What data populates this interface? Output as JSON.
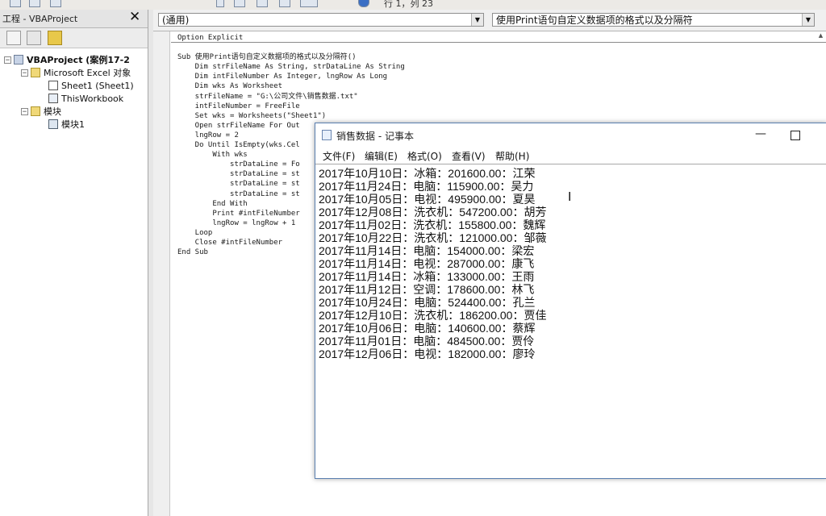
{
  "toolbar": {
    "right_text": "行 1，列 23"
  },
  "project_explorer": {
    "title": "工程 - VBAProject",
    "close_icon": "close-icon",
    "tree": {
      "root": "VBAProject (案例17-2",
      "excel_objects_folder": "Microsoft Excel 对象",
      "sheet1": "Sheet1 (Sheet1)",
      "thisworkbook": "ThisWorkbook",
      "modules_folder": "模块",
      "module1": "模块1"
    }
  },
  "editor": {
    "object_dropdown": "(通用)",
    "procedure_dropdown": "使用Print语句自定义数据项的格式以及分隔符",
    "code_lines": [
      "Option Explicit",
      "",
      "Sub 使用Print语句自定义数据项的格式以及分隔符()",
      "    Dim strFileName As String, strDataLine As String",
      "    Dim intFileNumber As Integer, lngRow As Long",
      "    Dim wks As Worksheet",
      "    strFileName = \"G:\\公司文件\\销售数据.txt\"",
      "    intFileNumber = FreeFile",
      "    Set wks = Worksheets(\"Sheet1\")",
      "    Open strFileName For Out",
      "    lngRow = 2",
      "    Do Until IsEmpty(wks.Cel",
      "        With wks",
      "            strDataLine = Fo",
      "            strDataLine = st",
      "            strDataLine = st",
      "            strDataLine = st",
      "        End With",
      "        Print #intFileNumber",
      "        lngRow = lngRow + 1",
      "    Loop",
      "    Close #intFileNumber",
      "End Sub"
    ]
  },
  "notepad": {
    "title": "销售数据 - 记事本",
    "menu": [
      "文件(F)",
      "编辑(E)",
      "格式(O)",
      "查看(V)",
      "帮助(H)"
    ],
    "lines": [
      "2017年10月10日：冰箱：201600.00：江荣",
      "2017年11月24日：电脑：115900.00：吴力",
      "2017年10月05日：电视：495900.00：夏昊",
      "2017年12月08日：洗衣机：547200.00：胡芳",
      "2017年11月02日：洗衣机：155800.00：魏辉",
      "2017年10月22日：洗衣机：121000.00：邹薇",
      "2017年11月14日：电脑：154000.00：梁宏",
      "2017年11月14日：电视：287000.00：康飞",
      "2017年11月14日：冰箱：133000.00：王雨",
      "2017年11月12日：空调：178600.00：林飞",
      "2017年10月24日：电脑：524400.00：孔兰",
      "2017年12月10日：洗衣机：186200.00：贾佳",
      "2017年10月06日：电脑：140600.00：蔡辉",
      "2017年11月01日：电脑：484500.00：贾伶",
      "2017年12月06日：电视：182000.00：廖玲"
    ]
  }
}
